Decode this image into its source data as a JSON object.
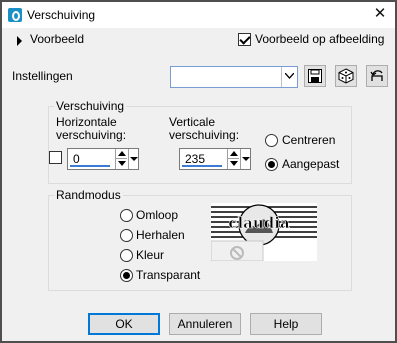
{
  "window": {
    "title": "Verschuiving",
    "close_glyph": "✕"
  },
  "preview_toggle": {
    "label": "Voorbeeld"
  },
  "preview_on_image": {
    "label": "Voorbeeld op afbeelding",
    "checked": true
  },
  "settings": {
    "label": "Instellingen",
    "value": ""
  },
  "offset_group": {
    "title": "Verschuiving",
    "horizontal_label_line1": "Horizontale",
    "horizontal_label_line2": "verschuiving:",
    "horizontal_value": "0",
    "vertical_label_line1": "Verticale",
    "vertical_label_line2": "verschuiving:",
    "vertical_value": "235",
    "center_label": "Centreren",
    "custom_label": "Aangepast",
    "selected": "custom"
  },
  "edge_group": {
    "title": "Randmodus",
    "options": [
      "Omloop",
      "Herhalen",
      "Kleur",
      "Transparant"
    ],
    "selected": "Transparant",
    "preview_text": "claudia"
  },
  "buttons": {
    "ok": "OK",
    "cancel": "Annuleren",
    "help": "Help"
  },
  "colors": {
    "accent": "#0078d7",
    "app_icon": "#1b8fc6"
  }
}
